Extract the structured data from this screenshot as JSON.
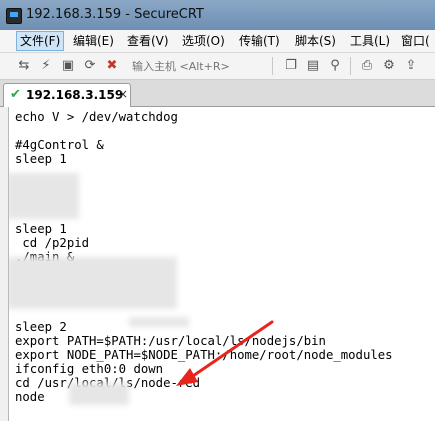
{
  "window": {
    "title": "192.168.3.159 - SecureCRT"
  },
  "menu": [
    {
      "label": "文件(F)",
      "active": true
    },
    {
      "label": "编辑(E)"
    },
    {
      "label": "查看(V)"
    },
    {
      "label": "选项(O)"
    },
    {
      "label": "传输(T)"
    },
    {
      "label": "脚本(S)"
    },
    {
      "label": "工具(L)"
    },
    {
      "label": "窗口("
    }
  ],
  "toolbar": {
    "host_placeholder": "输入主机 <Alt+R>",
    "icons": [
      "connect-icon",
      "quick-connect-icon",
      "session-icon",
      "reconnect-icon",
      "disconnect-icon",
      "copy-icon",
      "paste-icon",
      "find-icon",
      "print-icon",
      "options-icon",
      "sftp-icon"
    ]
  },
  "tabs": [
    {
      "label": "192.168.3.159",
      "status_icon": "check-icon"
    }
  ],
  "terminal": {
    "lines": [
      "echo V > /dev/watchdog",
      "",
      "#4gControl &",
      "sleep 1",
      "",
      "",
      "",
      "",
      "sleep 1",
      " cd /p2pid",
      "./main &",
      "sleep 1",
      "",
      "",
      "",
      "sleep 2",
      "export PATH=$PATH:/usr/local/ls/nodejs/bin",
      "export NODE_PATH=$NODE_PATH:/home/root/node_modules",
      "ifconfig eth0:0 down",
      "cd /usr/local/ls/node-red",
      "node"
    ]
  },
  "colors": {
    "arrow": "#e8251c",
    "titlebar": "#7b9bbd",
    "tab_check": "#2aa54a"
  }
}
